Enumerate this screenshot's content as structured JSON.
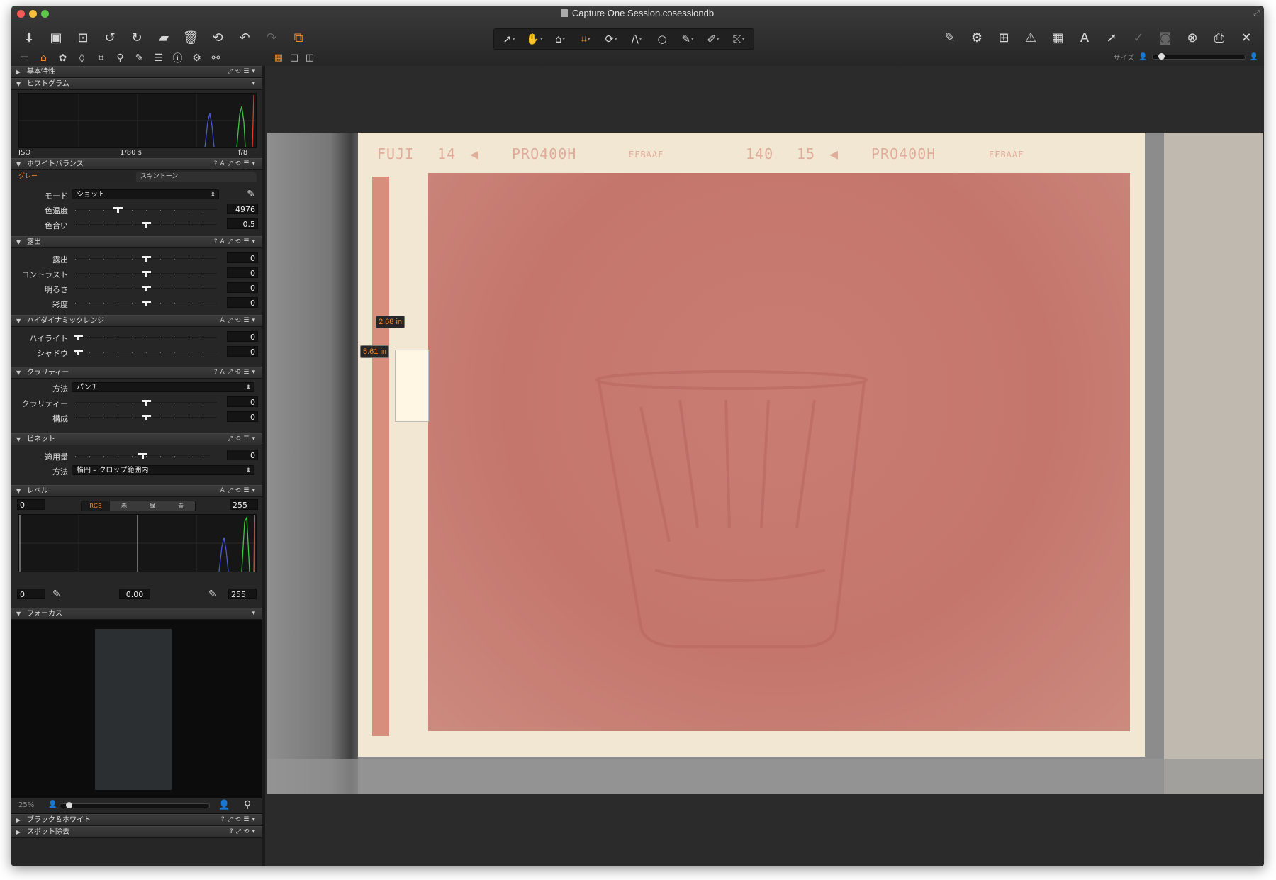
{
  "window": {
    "title": "Capture One Session.cosessiondb"
  },
  "toolbar": {
    "left": [
      "import-icon",
      "capture-icon",
      "capture-alt-icon",
      "rotate-left-icon",
      "rotate-right-icon",
      "move-to-folder-icon",
      "trash-icon",
      "reset-icon",
      "undo-icon",
      "redo-icon",
      "variants-icon"
    ],
    "center": [
      "select-cursor-icon",
      "pan-hand-icon",
      "loupe-icon",
      "crop-icon",
      "rotate-icon",
      "keystone-icon",
      "circle-mask-icon",
      "brush-icon",
      "eraser-icon",
      "picker-icon"
    ],
    "right": [
      "brush-icon",
      "settings-gear-icon",
      "layout-icon",
      "warning-triangle-icon",
      "grid-icon",
      "text-icon",
      "arrow-icon",
      "arrow-check-icon",
      "camera-icon",
      "circle-x-icon",
      "print-icon",
      "tools-icon"
    ]
  },
  "viewer_controls": {
    "size_label": "サイズ"
  },
  "panel": {
    "basic": {
      "title": "基本特性"
    },
    "histogram": {
      "title": "ヒストグラム",
      "iso": "ISO",
      "shutter": "1/80 s",
      "aperture": "f/8"
    },
    "white_balance": {
      "title": "ホワイトバランス",
      "tabs": [
        "グレー",
        "スキントーン"
      ],
      "mode_label": "モード",
      "mode_value": "ショット",
      "temp_label": "色温度",
      "temp_value": "4976",
      "temp_pos": 0.3,
      "tint_label": "色合い",
      "tint_value": "0.5",
      "tint_pos": 0.5
    },
    "exposure": {
      "title": "露出",
      "rows": [
        {
          "label": "露出",
          "value": "0"
        },
        {
          "label": "コントラスト",
          "value": "0"
        },
        {
          "label": "明るさ",
          "value": "0"
        },
        {
          "label": "彩度",
          "value": "0"
        }
      ]
    },
    "hdr": {
      "title": "ハイダイナミックレンジ",
      "rows": [
        {
          "label": "ハイライト",
          "value": "0"
        },
        {
          "label": "シャドウ",
          "value": "0"
        }
      ]
    },
    "clarity": {
      "title": "クラリティー",
      "method_label": "方法",
      "method_value": "パンチ",
      "rows": [
        {
          "label": "クラリティー",
          "value": "0"
        },
        {
          "label": "構成",
          "value": "0"
        }
      ]
    },
    "vignette": {
      "title": "ビネット",
      "amount_label": "適用量",
      "amount_value": "0",
      "method_label": "方法",
      "method_value": "楕円 – クロップ範囲内"
    },
    "levels": {
      "title": "レベル",
      "in_low": "0",
      "in_high": "255",
      "channels": [
        "RGB",
        "赤",
        "緑",
        "青"
      ],
      "out_low": "0",
      "mid": "0.00",
      "out_high": "255"
    },
    "focus": {
      "title": "フォーカス",
      "zoom": "25%"
    },
    "bw": {
      "title": "ブラック＆ホワイト"
    },
    "spot": {
      "title": "スポット除去"
    }
  },
  "image": {
    "film_text": [
      "FUJI",
      "14",
      "PRO400H",
      "EFBAAF",
      "140",
      "15",
      "PRO400H",
      "EFBAAF"
    ],
    "crop_width": "2.68 in",
    "crop_height": "5.61 in"
  }
}
